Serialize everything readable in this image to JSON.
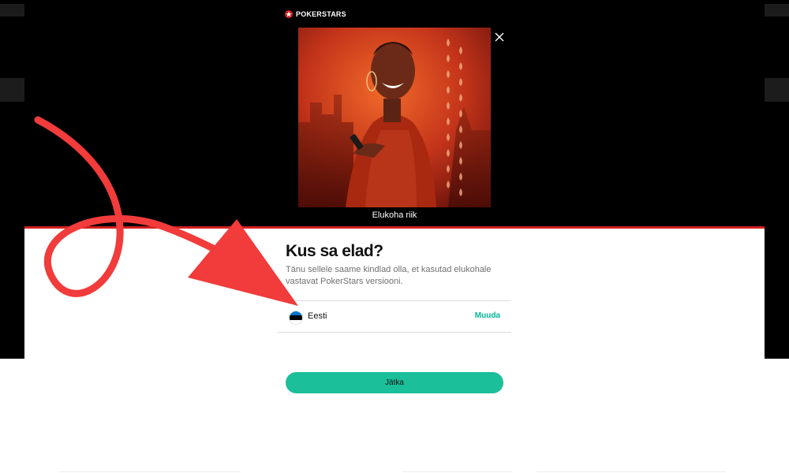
{
  "brand": {
    "logo_text": "POKERSTARS"
  },
  "hero": {
    "caption": "Elukoha riik"
  },
  "modal": {
    "title": "Kus sa elad?",
    "description": "Tänu sellele saame kindlad olla, et kasutad elukohale vastavat PokerStars versiooni.",
    "country": {
      "name": "Eesti",
      "change_label": "Muuda",
      "flag_colors": [
        "#0072ce",
        "#000000",
        "#ffffff"
      ]
    },
    "continue_label": "Jätka"
  },
  "colors": {
    "accent_red": "#d21f1f",
    "button_green": "#1bbf99",
    "link_green": "#00b896",
    "annotation_red": "#f23b3b"
  }
}
